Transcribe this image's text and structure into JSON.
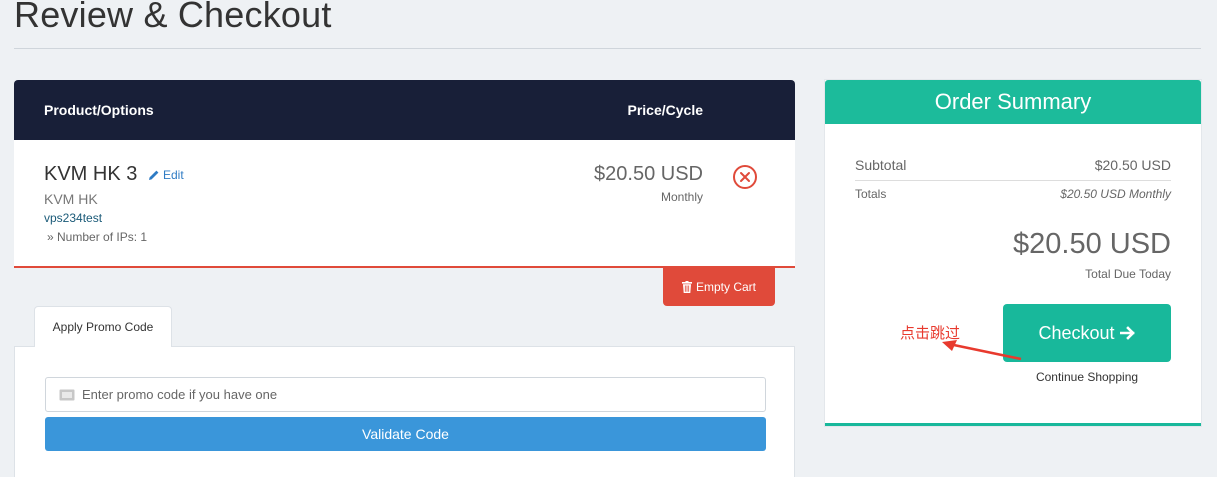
{
  "page": {
    "title": "Review & Checkout"
  },
  "cart": {
    "header": {
      "product_col": "Product/Options",
      "price_col": "Price/Cycle"
    },
    "items": [
      {
        "name": "KVM HK 3",
        "edit_label": "Edit",
        "group": "KVM HK",
        "hostname": "vps234test",
        "option": "» Number of IPs: 1",
        "price": "$20.50 USD",
        "cycle": "Monthly"
      }
    ],
    "empty_cart_label": "Empty Cart"
  },
  "promo": {
    "tab_label": "Apply Promo Code",
    "input_placeholder": "Enter promo code if you have one",
    "input_value": "",
    "validate_label": "Validate Code"
  },
  "summary": {
    "title": "Order Summary",
    "subtotal_label": "Subtotal",
    "subtotal_value": "$20.50 USD",
    "totals_label": "Totals",
    "totals_value": "$20.50 USD Monthly",
    "due_amount": "$20.50 USD",
    "due_label": "Total Due Today",
    "checkout_label": "Checkout",
    "continue_label": "Continue Shopping"
  },
  "annotation": {
    "text": "点击跳过",
    "color": "#e83a2e"
  },
  "colors": {
    "header_bg": "#181f38",
    "accent_green": "#1cbb9b",
    "danger_red": "#e04a3a",
    "primary_blue": "#3a96da"
  },
  "icons": {
    "edit": "pencil-icon",
    "remove": "close-circle-icon",
    "empty_cart": "trash-icon",
    "promo": "ticket-icon",
    "checkout": "arrow-right-icon"
  }
}
